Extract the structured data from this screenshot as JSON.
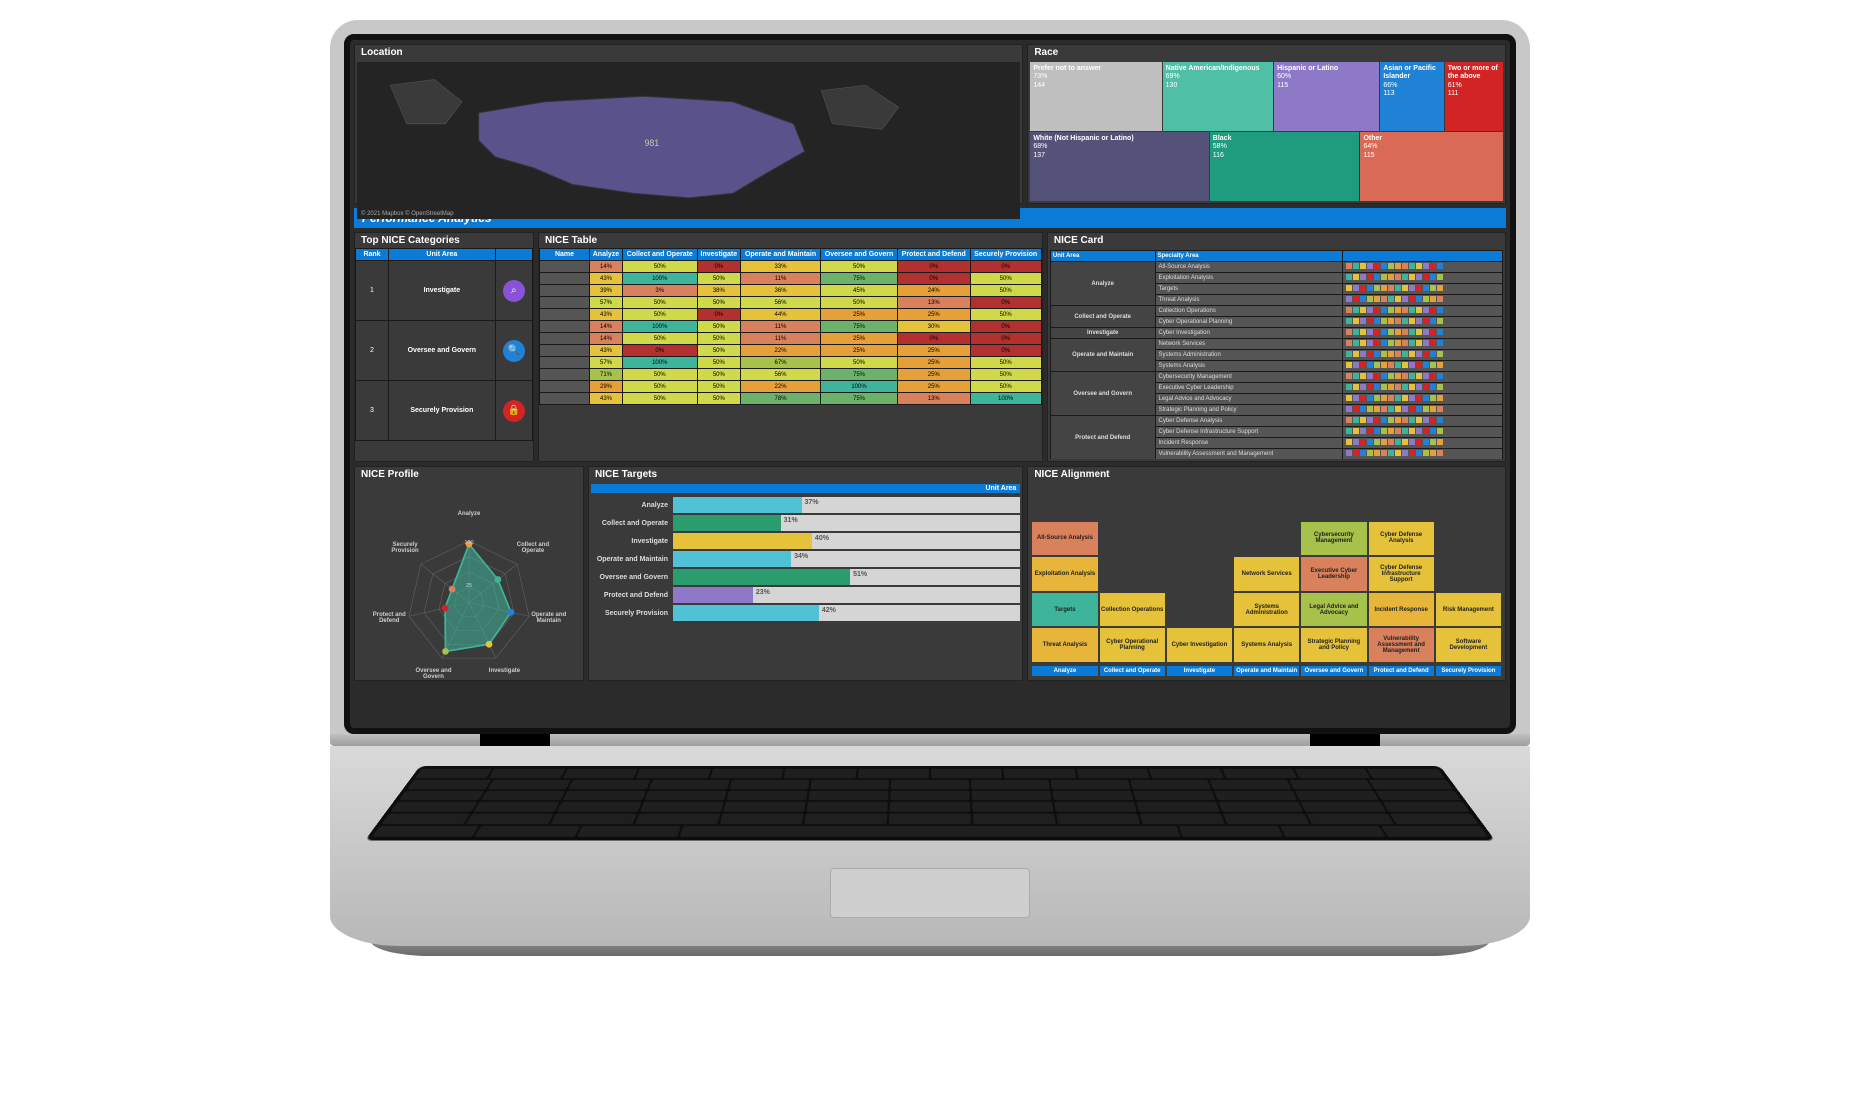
{
  "panels": {
    "location": "Location",
    "race": "Race",
    "performance": "Performance Analytics",
    "top_nice": "Top NICE Categories",
    "nice_table": "NICE Table",
    "nice_card": "NICE Card",
    "nice_profile": "NICE Profile",
    "nice_targets": "NICE Targets",
    "nice_alignment": "NICE Alignment"
  },
  "map": {
    "value": "981",
    "attribution": "© 2021 Mapbox © OpenStreetMap"
  },
  "race_tiles": [
    {
      "label": "Prefer not to answer",
      "pct": "73%",
      "count": "144",
      "color": "#bfbfbf",
      "w": 1.2
    },
    {
      "label": "Native American/Indigenous",
      "pct": "69%",
      "count": "130",
      "color": "#4fbfa6",
      "w": 1.0
    },
    {
      "label": "Hispanic or Latino",
      "pct": "60%",
      "count": "115",
      "color": "#8e79c9",
      "w": 0.95
    },
    {
      "label": "Asian or Pacific Islander",
      "pct": "66%",
      "count": "113",
      "color": "#1f82d6",
      "w": 0.55
    },
    {
      "label": "Two or more of the above",
      "pct": "61%",
      "count": "111",
      "color": "#d22424",
      "w": 0.5
    },
    {
      "label": "White (Not Hispanic or Latino)",
      "pct": "68%",
      "count": "137",
      "color": "#55527a",
      "w": 1.2
    },
    {
      "label": "Black",
      "pct": "58%",
      "count": "116",
      "color": "#1f9c7e",
      "w": 1.0
    },
    {
      "label": "Other",
      "pct": "64%",
      "count": "115",
      "color": "#d96a55",
      "w": 0.95
    }
  ],
  "top_nice": {
    "headers": [
      "Rank",
      "Unit Area",
      ""
    ],
    "rows": [
      {
        "rank": "1",
        "area": "Investigate",
        "color": "#8a52d6",
        "icon": "search"
      },
      {
        "rank": "2",
        "area": "Oversee and Govern",
        "color": "#1f82d6",
        "icon": "magnify"
      },
      {
        "rank": "3",
        "area": "Securely Provision",
        "color": "#d22424",
        "icon": "lock"
      }
    ]
  },
  "nice_table_headers": [
    "Name",
    "Analyze",
    "Collect and Operate",
    "Investigate",
    "Operate and Maintain",
    "Oversee and Govern",
    "Protect and Defend",
    "Securely Provision"
  ],
  "nice_card": {
    "headers": [
      "Unit Area",
      "Specialty Area",
      ""
    ],
    "rows": [
      {
        "ua": "Analyze",
        "items": [
          "All-Source Analysis",
          "Exploitation Analysis",
          "Targets",
          "Threat Analysis"
        ]
      },
      {
        "ua": "Collect and Operate",
        "items": [
          "Collection Operations",
          "Cyber Operational Planning"
        ]
      },
      {
        "ua": "Investigate",
        "items": [
          "Cyber Investigation"
        ]
      },
      {
        "ua": "Operate and Maintain",
        "items": [
          "Network Services",
          "Systems Administration",
          "Systems Analysis"
        ]
      },
      {
        "ua": "Oversee and Govern",
        "items": [
          "Cybersecurity Management",
          "Executive Cyber Leadership",
          "Legal Advice and Advocacy",
          "Strategic Planning and Policy"
        ]
      },
      {
        "ua": "Protect and Defend",
        "items": [
          "Cyber Defense Analysis",
          "Cyber Defense Infrastructure Support",
          "Incident Response",
          "Vulnerability Assessment and Management"
        ]
      },
      {
        "ua": "Securely Provision",
        "items": [
          "Risk Management",
          "Software Development"
        ]
      }
    ]
  },
  "targets_header": "Unit Area",
  "alignment": {
    "footers": [
      "Analyze",
      "Collect and Operate",
      "Investigate",
      "Operate and Maintain",
      "Oversee and Govern",
      "Protect and Defend",
      "Securely Provision"
    ]
  },
  "chart_data": {
    "race_treemap": {
      "type": "treemap",
      "title": "Race",
      "series": [
        {
          "name": "Prefer not to answer",
          "pct": 73,
          "count": 144
        },
        {
          "name": "Native American/Indigenous",
          "pct": 69,
          "count": 130
        },
        {
          "name": "Hispanic or Latino",
          "pct": 60,
          "count": 115
        },
        {
          "name": "Asian or Pacific Islander",
          "pct": 66,
          "count": 113
        },
        {
          "name": "Two or more of the above",
          "pct": 61,
          "count": 111
        },
        {
          "name": "White (Not Hispanic or Latino)",
          "pct": 68,
          "count": 137
        },
        {
          "name": "Black",
          "pct": 58,
          "count": 116
        },
        {
          "name": "Other",
          "pct": 64,
          "count": 115
        }
      ]
    },
    "nice_heatmap": {
      "type": "heatmap",
      "title": "NICE Table",
      "xlabels": [
        "Analyze",
        "Collect and Operate",
        "Investigate",
        "Operate and Maintain",
        "Oversee and Govern",
        "Protect and Defend",
        "Securely Provision"
      ],
      "rows": [
        [
          14,
          50,
          0,
          33,
          50,
          0,
          0
        ],
        [
          43,
          100,
          50,
          11,
          75,
          0,
          50
        ],
        [
          39,
          3,
          38,
          36,
          45,
          24,
          50
        ],
        [
          57,
          50,
          50,
          56,
          50,
          13,
          0
        ],
        [
          43,
          50,
          0,
          44,
          25,
          25,
          50
        ],
        [
          14,
          100,
          50,
          11,
          75,
          30,
          0
        ],
        [
          14,
          50,
          50,
          11,
          25,
          0,
          0
        ],
        [
          43,
          0,
          50,
          22,
          25,
          25,
          0
        ],
        [
          57,
          100,
          50,
          67,
          50,
          25,
          50
        ],
        [
          71,
          50,
          50,
          56,
          75,
          25,
          50
        ],
        [
          29,
          50,
          50,
          22,
          100,
          25,
          50
        ],
        [
          43,
          50,
          50,
          78,
          75,
          13,
          100
        ]
      ]
    },
    "nice_radar": {
      "type": "radar",
      "title": "NICE Profile",
      "categories": [
        "Analyze",
        "Collect and Operate",
        "Operate and Maintain",
        "Investigate",
        "Oversee and Govern",
        "Protect and Defend",
        "Securely Provision"
      ],
      "values": [
        95,
        60,
        70,
        75,
        88,
        40,
        35
      ],
      "rings": [
        25,
        100
      ]
    },
    "nice_targets": {
      "type": "bar",
      "title": "NICE Targets",
      "orientation": "horizontal",
      "xlim": [
        0,
        100
      ],
      "series": [
        {
          "name": "Analyze",
          "value": 37,
          "color": "#51c2d6"
        },
        {
          "name": "Collect and Operate",
          "value": 31,
          "color": "#2b9c6e"
        },
        {
          "name": "Investigate",
          "value": 40,
          "color": "#e6c23a"
        },
        {
          "name": "Operate and Maintain",
          "value": 34,
          "color": "#51c2d6"
        },
        {
          "name": "Oversee and Govern",
          "value": 51,
          "color": "#2b9c6e"
        },
        {
          "name": "Protect and Defend",
          "value": 23,
          "color": "#8e79c9"
        },
        {
          "name": "Securely Provision",
          "value": 42,
          "color": "#51c2d6"
        }
      ]
    },
    "nice_alignment": {
      "type": "table",
      "title": "NICE Alignment",
      "columns": [
        "Analyze",
        "Collect and Operate",
        "Investigate",
        "Operate and Maintain",
        "Oversee and Govern",
        "Protect and Defend",
        "Securely Provision"
      ],
      "grid": [
        [
          "All-Source Analysis",
          "",
          "",
          "",
          "Cybersecurity Management",
          "Cyber Defense Analysis",
          ""
        ],
        [
          "Exploitation Analysis",
          "",
          "",
          "Network Services",
          "Executive Cyber Leadership",
          "Cyber Defense Infrastructure Support",
          ""
        ],
        [
          "Targets",
          "Collection Operations",
          "",
          "Systems Administration",
          "Legal Advice and Advocacy",
          "Incident Response",
          "Risk Management"
        ],
        [
          "Threat Analysis",
          "Cyber Operational Planning",
          "Cyber Investigation",
          "Systems Analysis",
          "Strategic Planning and Policy",
          "Vulnerability Assessment and Management",
          "Software Development"
        ]
      ],
      "colors": [
        [
          "#d9805c",
          "",
          "",
          "",
          "#a7c24a",
          "#e6c23a",
          ""
        ],
        [
          "#e6b53a",
          "",
          "",
          "#e6c23a",
          "#d9805c",
          "#e6c23a",
          ""
        ],
        [
          "#3eb59a",
          "#e6c23a",
          "",
          "#e6c23a",
          "#a7c24a",
          "#e6b53a",
          "#e6c23a"
        ],
        [
          "#e6b53a",
          "#e6c23a",
          "#e6c23a",
          "#e6c23a",
          "#e6c23a",
          "#d9805c",
          "#e6c23a"
        ]
      ]
    }
  }
}
